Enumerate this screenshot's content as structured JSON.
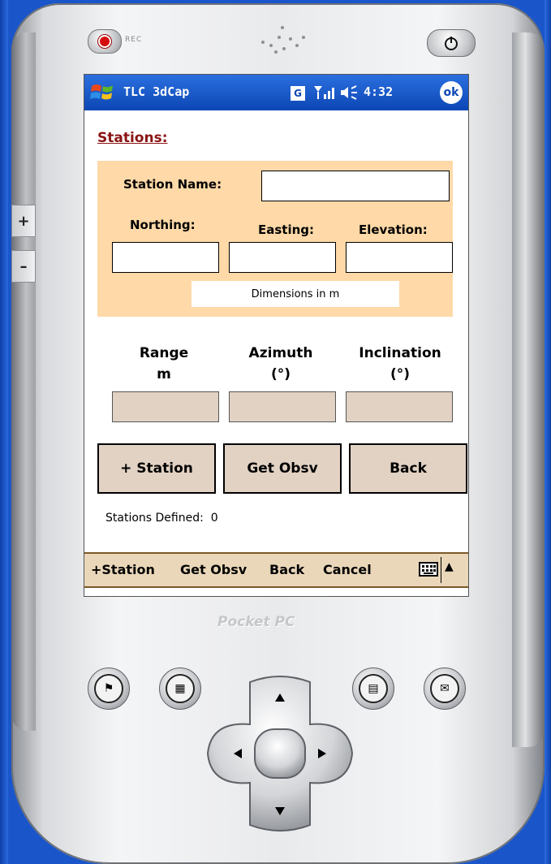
{
  "taskbar": {
    "title": "TLC 3dCap",
    "g_icon": "G",
    "time": "4:32",
    "ok": "ok"
  },
  "device": {
    "rec_label": "REC",
    "brand": "Pocket PC",
    "side_plus": "+",
    "side_minus": "–"
  },
  "form": {
    "heading": "Stations:",
    "station_name_label": "Station Name:",
    "station_name_value": "",
    "northing_label": "Northing:",
    "easting_label": "Easting:",
    "elevation_label": "Elevation:",
    "northing_value": "",
    "easting_value": "",
    "elevation_value": "",
    "dimensions_note": "Dimensions in m",
    "range_label": "Range",
    "range_unit": "m",
    "azimuth_label": "Azimuth",
    "azimuth_unit": "(°)",
    "inclination_label": "Inclination",
    "inclination_unit": "(°)"
  },
  "buttons": {
    "add_station": "+ Station",
    "get_obsv": "Get Obsv",
    "back": "Back"
  },
  "status": {
    "stations_defined_label": "Stations Defined:",
    "stations_defined_value": "0"
  },
  "menu": {
    "items": [
      "+Station",
      "Get Obsv",
      "Back",
      "Cancel"
    ],
    "up_arrow": "▲"
  },
  "colors": {
    "taskbar": "#0c47b4",
    "panel": "#ffd9a8",
    "heading": "#8b1414",
    "button_face": "#e1d2c4",
    "menubar": "#ead7b9"
  }
}
